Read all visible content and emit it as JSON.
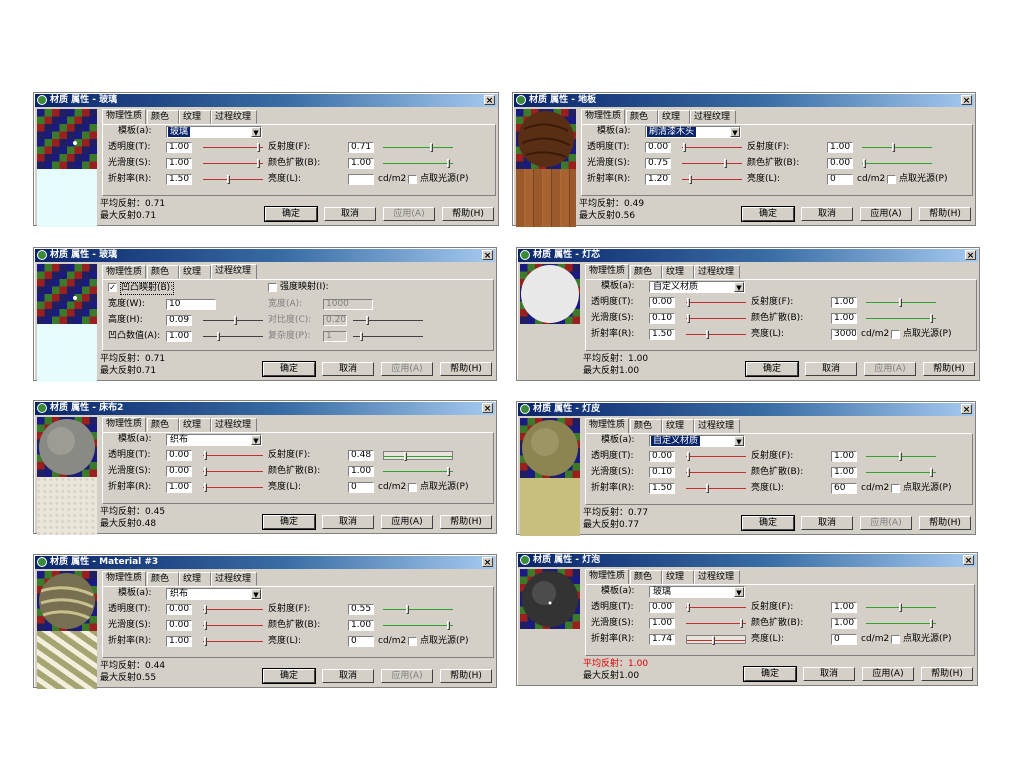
{
  "colors": {
    "track_red": "#c03030",
    "track_green": "#30a030",
    "title_dark": "#0a246a",
    "face": "#d4d0c8",
    "status_red": "#e00000"
  },
  "dialogs": [
    {
      "title": "材质 属性 - 玻璃",
      "preview": "checker",
      "bottom": "cyan",
      "tabs": [
        "物理性质",
        "颜色",
        "纹理",
        "过程纹理"
      ],
      "active_tab": 0,
      "mode": "physical",
      "template_label": "模板(a):",
      "template_value": "玻璃",
      "template_highlight": true,
      "rows": [
        {
          "l1": "透明度(T):",
          "v1": "1.00",
          "s1": 0.97,
          "l2": "反射度(F):",
          "v2": "0.71",
          "s2": 0.71
        },
        {
          "l1": "光滑度(S):",
          "v1": "1.00",
          "s1": 0.97,
          "l2": "颜色扩散(B):",
          "v2": "1.00",
          "s2": 0.97
        },
        {
          "l1": "折射率(R):",
          "v1": "1.50",
          "s1": 0.42,
          "l2": "亮度(L):",
          "v2": "",
          "unit": "cd/m2",
          "check": "点取光源(P)"
        }
      ],
      "avg": "平均反射：0.71",
      "max": "最大反射0.71",
      "buttons": [
        "确定",
        "取消",
        "应用(A)",
        "帮助(H)"
      ],
      "apply_disabled": true,
      "avg_red": false
    },
    {
      "title": "材质 属性 - 地板",
      "preview": "wood",
      "bottom": "woodplanks",
      "tabs": [
        "物理性质",
        "颜色",
        "纹理",
        "过程纹理"
      ],
      "active_tab": 0,
      "mode": "physical",
      "template_label": "模板(a):",
      "template_value": "刷清漆木头",
      "template_highlight": true,
      "rows": [
        {
          "l1": "透明度(T):",
          "v1": "0.00",
          "s1": 0.02,
          "l2": "反射度(F):",
          "v2": "1.00",
          "s2": 0.45
        },
        {
          "l1": "光滑度(S):",
          "v1": "0.75",
          "s1": 0.75,
          "l2": "颜色扩散(B):",
          "v2": "0.00",
          "s2": 0.02
        },
        {
          "l1": "折射率(R):",
          "v1": "1.20",
          "s1": 0.12,
          "l2": "亮度(L):",
          "v2": "0",
          "unit": "cd/m2",
          "check": "点取光源(P)"
        }
      ],
      "avg": "平均反射：0.49",
      "max": "最大反射0.56",
      "buttons": [
        "确定",
        "取消",
        "应用(A)",
        "帮助(H)"
      ],
      "apply_disabled": false,
      "avg_red": false
    },
    {
      "title": "材质 属性 - 玻璃",
      "preview": "checker",
      "bottom": "cyan",
      "tabs": [
        "物理性质",
        "颜色",
        "纹理",
        "过程纹理"
      ],
      "active_tab": 3,
      "mode": "procedural",
      "bump_label": "凹凸映射(B):",
      "intensity_label": "强度映射(I):",
      "proc_rows": [
        {
          "l1": "宽度(W):",
          "v1": "10",
          "l2": "宽度(A):",
          "v2": "1000"
        },
        {
          "l1": "高度(H):",
          "v1": "0.09",
          "s1": 0.55,
          "l2": "对比度(C):",
          "v2": "0.20",
          "s2": 0.2
        },
        {
          "l1": "凹凸数值(A):",
          "v1": "1.00",
          "s1": 0.25,
          "l2": "复杂度(P):",
          "v2": "1",
          "s2": 0.1
        }
      ],
      "avg": "平均反射：0.71",
      "max": "最大反射0.71",
      "buttons": [
        "确定",
        "取消",
        "应用(A)",
        "帮助(H)"
      ],
      "apply_disabled": true,
      "avg_red": false
    },
    {
      "title": "材质 属性 - 灯芯",
      "preview": "whitesphere",
      "bottom": "none",
      "tabs": [
        "物理性质",
        "颜色",
        "纹理",
        "过程纹理"
      ],
      "active_tab": 0,
      "mode": "physical",
      "template_label": "模板(a):",
      "template_value": "自定义材质",
      "template_highlight": false,
      "rows": [
        {
          "l1": "透明度(T):",
          "v1": "0.00",
          "s1": 0.02,
          "l2": "反射度(F):",
          "v2": "1.00",
          "s2": 0.5
        },
        {
          "l1": "光滑度(S):",
          "v1": "0.10",
          "s1": 0.02,
          "l2": "颜色扩散(B):",
          "v2": "1.00",
          "s2": 0.97
        },
        {
          "l1": "折射率(R):",
          "v1": "1.50",
          "s1": 0.35,
          "l2": "亮度(L):",
          "v2": "3000",
          "unit": "cd/m2",
          "check": "点取光源(P)"
        }
      ],
      "avg": "平均反射：1.00",
      "max": "最大反射1.00",
      "buttons": [
        "确定",
        "取消",
        "应用(A)",
        "帮助(H)"
      ],
      "apply_disabled": true,
      "avg_red": false
    },
    {
      "title": "材质 属性 - 床布2",
      "preview": "graysphere",
      "bottom": "speckle",
      "tabs": [
        "物理性质",
        "颜色",
        "纹理",
        "过程纹理"
      ],
      "active_tab": 0,
      "mode": "physical",
      "template_label": "模板(a):",
      "template_value": "织布",
      "template_highlight": false,
      "rows": [
        {
          "l1": "透明度(T):",
          "v1": "0.00",
          "s1": 0.02,
          "l2": "反射度(F):",
          "v2": "0.48",
          "s2": 0.3,
          "s2_box": true
        },
        {
          "l1": "光滑度(S):",
          "v1": "0.00",
          "s1": 0.02,
          "l2": "颜色扩散(B):",
          "v2": "1.00",
          "s2": 0.97
        },
        {
          "l1": "折射率(R):",
          "v1": "1.00",
          "s1": 0.02,
          "l2": "亮度(L):",
          "v2": "0",
          "unit": "cd/m2",
          "check": "点取光源(P)"
        }
      ],
      "avg": "平均反射：0.45",
      "max": "最大反射0.48",
      "buttons": [
        "确定",
        "取消",
        "应用(A)",
        "帮助(H)"
      ],
      "apply_disabled": false,
      "avg_red": false
    },
    {
      "title": "材质 属性 - 灯皮",
      "preview": "oliveshere",
      "bottom": "olive",
      "tabs": [
        "物理性质",
        "颜色",
        "纹理",
        "过程纹理"
      ],
      "active_tab": 0,
      "mode": "physical",
      "template_label": "模板(a):",
      "template_value": "自定义材质",
      "template_highlight": true,
      "rows": [
        {
          "l1": "透明度(T):",
          "v1": "0.00",
          "s1": 0.02,
          "l2": "反射度(F):",
          "v2": "1.00",
          "s2": 0.5
        },
        {
          "l1": "光滑度(S):",
          "v1": "0.10",
          "s1": 0.02,
          "l2": "颜色扩散(B):",
          "v2": "1.00",
          "s2": 0.97
        },
        {
          "l1": "折射率(R):",
          "v1": "1.50",
          "s1": 0.35,
          "l2": "亮度(L):",
          "v2": "60",
          "unit": "cd/m2",
          "check": "点取光源(P)"
        }
      ],
      "avg": "平均反射：0.77",
      "max": "最大反射0.77",
      "buttons": [
        "确定",
        "取消",
        "应用(A)",
        "帮助(H)"
      ],
      "apply_disabled": true,
      "avg_red": false
    },
    {
      "title": "材质 属性 - Material #3",
      "preview": "zebrasphere",
      "bottom": "zebra",
      "tabs": [
        "物理性质",
        "颜色",
        "纹理",
        "过程纹理"
      ],
      "active_tab": 0,
      "mode": "physical",
      "template_label": "模板(a):",
      "template_value": "织布",
      "template_highlight": false,
      "rows": [
        {
          "l1": "透明度(T):",
          "v1": "0.00",
          "s1": 0.02,
          "l2": "反射度(F):",
          "v2": "0.55",
          "s2": 0.35
        },
        {
          "l1": "光滑度(S):",
          "v1": "0.00",
          "s1": 0.02,
          "l2": "颜色扩散(B):",
          "v2": "1.00",
          "s2": 0.97
        },
        {
          "l1": "折射率(R):",
          "v1": "1.00",
          "s1": 0.02,
          "l2": "亮度(L):",
          "v2": "0",
          "unit": "cd/m2",
          "check": "点取光源(P)"
        }
      ],
      "avg": "平均反射：0.44",
      "max": "最大反射0.55",
      "buttons": [
        "确定",
        "取消",
        "应用(A)",
        "帮助(H)"
      ],
      "apply_disabled": true,
      "avg_red": false
    },
    {
      "title": "材质 属性 - 灯泡",
      "preview": "darksphere",
      "bottom": "none",
      "tabs": [
        "物理性质",
        "颜色",
        "纹理",
        "过程纹理"
      ],
      "active_tab": 0,
      "mode": "physical",
      "template_label": "模板(a):",
      "template_value": "玻璃",
      "template_highlight": false,
      "rows": [
        {
          "l1": "透明度(T):",
          "v1": "0.00",
          "s1": 0.02,
          "l2": "反射度(F):",
          "v2": "1.00",
          "s2": 0.5
        },
        {
          "l1": "光滑度(S):",
          "v1": "1.00",
          "s1": 0.97,
          "l2": "颜色扩散(B):",
          "v2": "1.00",
          "s2": 0.97
        },
        {
          "l1": "折射率(R):",
          "v1": "1.74",
          "s1": 0.45,
          "s1_box": true,
          "l2": "亮度(L):",
          "v2": "0",
          "unit": "cd/m2",
          "check": "点取光源(P)"
        }
      ],
      "avg": "平均反射：1.00",
      "max": "最大反射1.00",
      "buttons": [
        "确定",
        "取消",
        "应用(A)",
        "帮助(H)"
      ],
      "apply_disabled": false,
      "avg_red": true
    }
  ]
}
